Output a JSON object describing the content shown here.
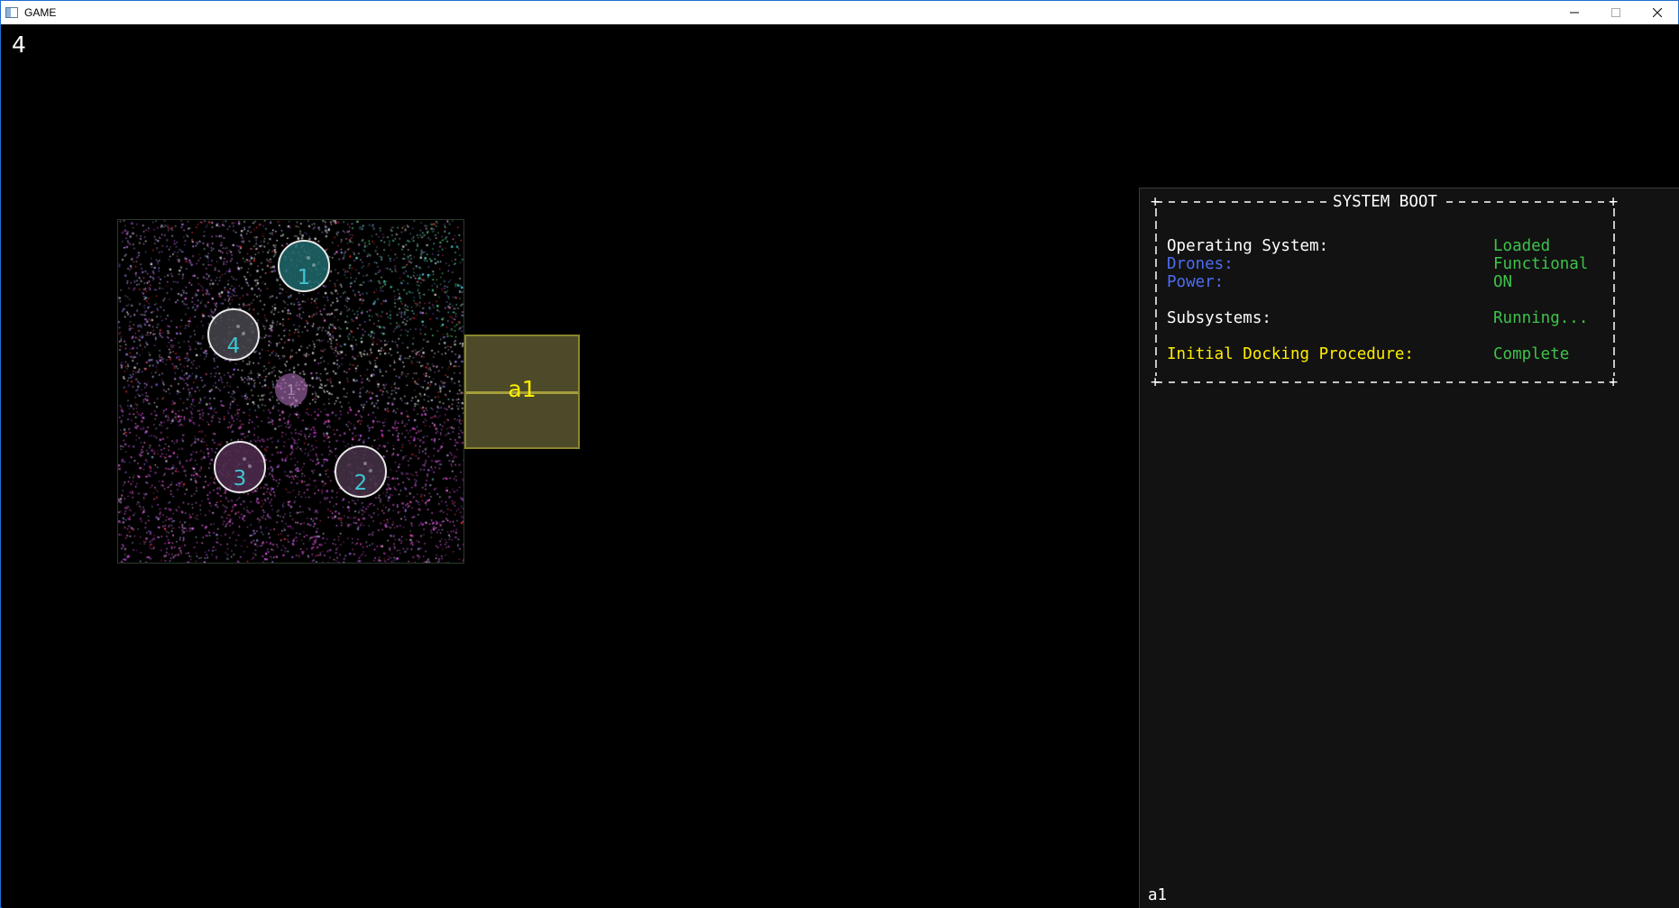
{
  "window": {
    "title": "GAME",
    "controls": {
      "minimize_icon": "minimize-icon",
      "maximize_icon": "maximize-icon",
      "close_icon": "close-icon"
    }
  },
  "hud": {
    "counter": "4"
  },
  "arena": {
    "drones": [
      {
        "id": "1",
        "color": "#1f686c"
      },
      {
        "id": "2",
        "color": "#46324a"
      },
      {
        "id": "3",
        "color": "#502d50"
      },
      {
        "id": "4",
        "color": "#46464e"
      }
    ],
    "target_marker": {
      "label": "1"
    },
    "label_color": "#3ec5d4"
  },
  "dock": {
    "label": "a1",
    "label_color": "#ffee00",
    "fill": "#4d4a2a"
  },
  "terminal": {
    "header": "SYSTEM BOOT",
    "rows": [
      {
        "key": "Operating System:",
        "value": "Loaded",
        "key_color": "#ffffff"
      },
      {
        "key": "Drones:",
        "value": "Functional",
        "key_color": "#4d6df0"
      },
      {
        "key": "Power:",
        "value": "ON",
        "key_color": "#4d6df0"
      },
      {
        "key": "Subsystems:",
        "value": "Running...",
        "key_color": "#ffffff"
      },
      {
        "key": "Initial Docking Procedure:",
        "value": "Complete",
        "key_color": "#ffee00"
      }
    ],
    "value_color": "#3ec34a",
    "prompt": "a1"
  }
}
